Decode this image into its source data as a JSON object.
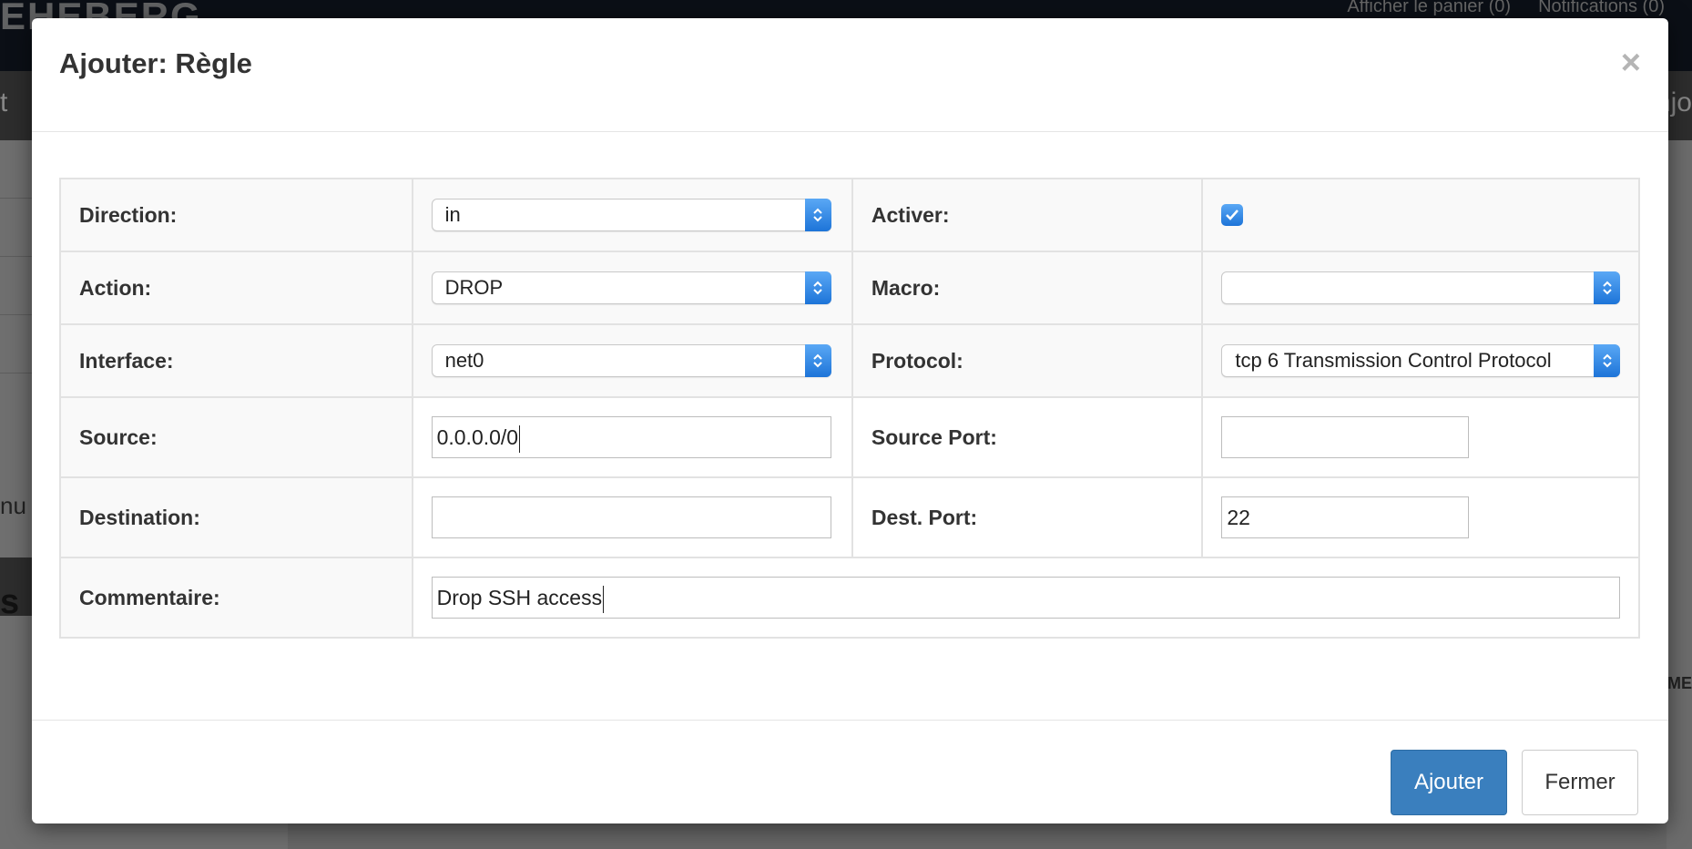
{
  "background": {
    "brand": "EHEBERG",
    "top_links": [
      "Afficher le panier (0)",
      "Notifications (0)"
    ],
    "nav_left": "t",
    "nav_right": "njo",
    "side_text_1": "nu",
    "side_text_2": "s",
    "right_text": "ME"
  },
  "modal": {
    "title": "Ajouter: Règle",
    "close": "×",
    "rows": {
      "direction": {
        "label": "Direction:",
        "value": "in"
      },
      "activer": {
        "label": "Activer:",
        "checked": true
      },
      "action": {
        "label": "Action:",
        "value": "DROP"
      },
      "macro": {
        "label": "Macro:",
        "value": ""
      },
      "interface": {
        "label": "Interface:",
        "value": "net0"
      },
      "protocol": {
        "label": "Protocol:",
        "value": "tcp 6 Transmission Control Protocol"
      },
      "source": {
        "label": "Source:",
        "value": "0.0.0.0/0"
      },
      "source_port": {
        "label": "Source Port:",
        "value": ""
      },
      "destination": {
        "label": "Destination:",
        "value": ""
      },
      "dest_port": {
        "label": "Dest. Port:",
        "value": "22"
      },
      "commentaire": {
        "label": "Commentaire:",
        "value": "Drop SSH access"
      }
    },
    "footer": {
      "submit_label": "Ajouter",
      "close_label": "Fermer"
    }
  },
  "colors": {
    "primary": "#3a7fbe",
    "select_arrow": "#1d74d8"
  }
}
